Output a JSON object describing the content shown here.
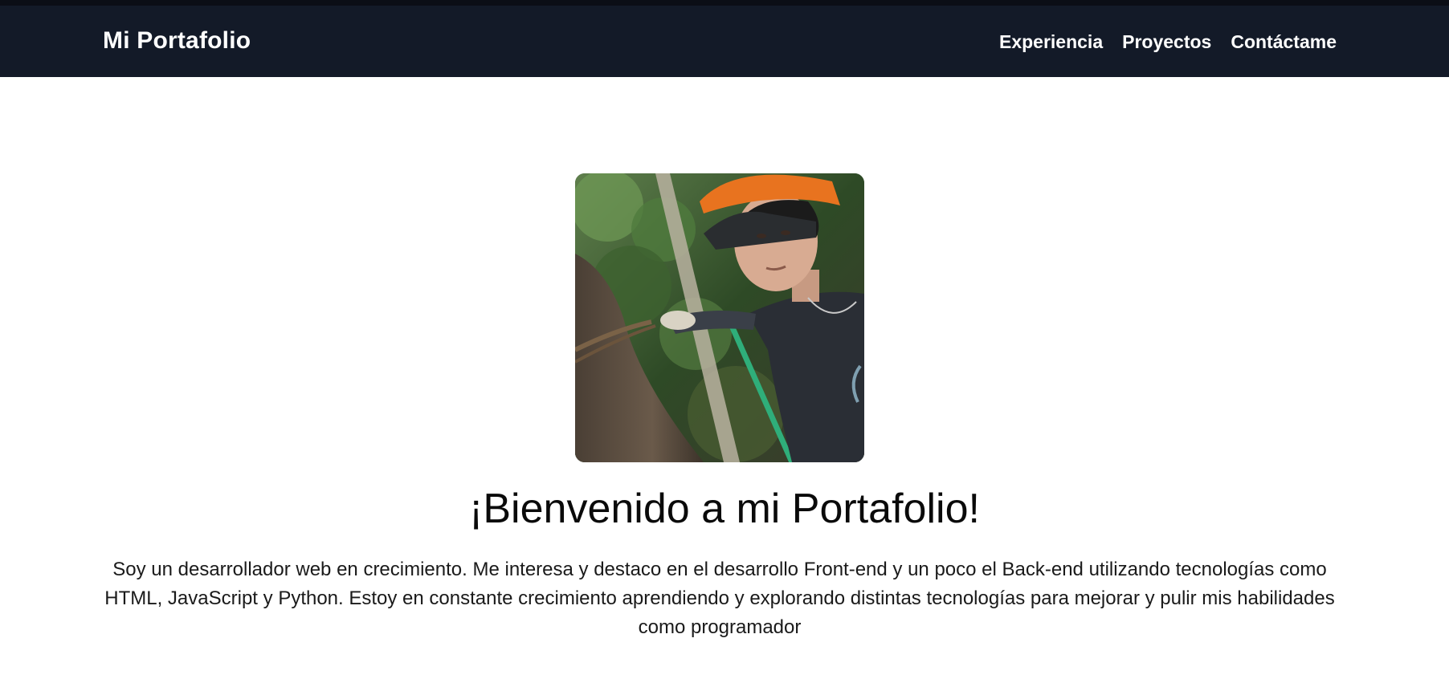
{
  "navbar": {
    "brand": "Mi Portafolio",
    "links": [
      {
        "label": "Experiencia"
      },
      {
        "label": "Proyectos"
      },
      {
        "label": "Contáctame"
      }
    ]
  },
  "hero": {
    "photo_icon": "profile-photo",
    "title": "¡Bienvenido a mi Portafolio!",
    "description": "Soy un desarrollador web en crecimiento. Me interesa y destaco en el desarrollo Front-end y un poco el Back-end utilizando tecnologías como HTML, JavaScript y Python. Estoy en constante crecimiento aprendiendo y explorando distintas tecnologías para mejorar y pulir mis habilidades como programador"
  },
  "colors": {
    "navbar_bg": "#131a28",
    "top_strip": "#0b0e16",
    "page_bg": "#ffffff",
    "nav_text": "#ffffff"
  }
}
